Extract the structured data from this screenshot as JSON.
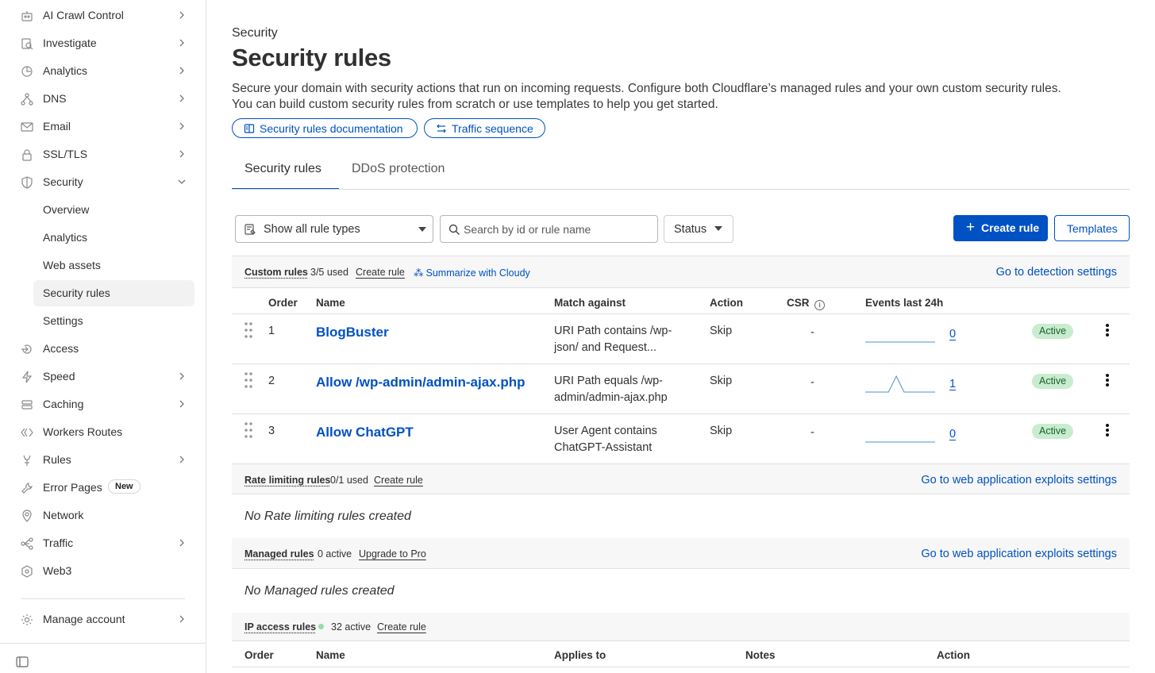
{
  "sidebar": {
    "items": [
      {
        "label": "AI Crawl Control",
        "icon": "robot-icon",
        "chevron": "right"
      },
      {
        "label": "Investigate",
        "icon": "investigate-icon",
        "chevron": "right"
      },
      {
        "label": "Analytics",
        "icon": "analytics-icon",
        "chevron": "right"
      },
      {
        "label": "DNS",
        "icon": "dns-icon",
        "chevron": "right"
      },
      {
        "label": "Email",
        "icon": "email-icon",
        "chevron": "right"
      },
      {
        "label": "SSL/TLS",
        "icon": "lock-icon",
        "chevron": "right"
      },
      {
        "label": "Security",
        "icon": "shield-icon",
        "chevron": "down"
      }
    ],
    "security_sub": [
      "Overview",
      "Analytics",
      "Web assets",
      "Security rules",
      "Settings"
    ],
    "items_after": [
      {
        "label": "Access",
        "icon": "access-icon",
        "chevron": ""
      },
      {
        "label": "Speed",
        "icon": "lightning-icon",
        "chevron": "right"
      },
      {
        "label": "Caching",
        "icon": "caching-icon",
        "chevron": "right"
      },
      {
        "label": "Workers Routes",
        "icon": "workers-icon",
        "chevron": ""
      },
      {
        "label": "Rules",
        "icon": "rules-icon",
        "chevron": "right"
      },
      {
        "label": "Error Pages",
        "icon": "wrench-icon",
        "chevron": "",
        "badge": "New"
      },
      {
        "label": "Network",
        "icon": "location-pin-icon",
        "chevron": ""
      },
      {
        "label": "Traffic",
        "icon": "traffic-icon",
        "chevron": "right"
      },
      {
        "label": "Web3",
        "icon": "web3-icon",
        "chevron": ""
      }
    ],
    "manage_account": "Manage account"
  },
  "header": {
    "breadcrumb": "Security",
    "title": "Security rules",
    "description_1": "Secure your domain with security actions that run on incoming requests. Configure both Cloudflare’s managed rules and your own custom security rules.",
    "description_2": "You can build custom security rules from scratch or use templates to help you get started.",
    "doc_link": "Security rules documentation",
    "traffic_link": "Traffic sequence"
  },
  "tabs": [
    "Security rules",
    "DDoS protection"
  ],
  "toolbar": {
    "rule_types": "Show all rule types",
    "search_placeholder": "Search by id or rule name",
    "status": "Status",
    "create_rule": "Create rule",
    "templates": "Templates"
  },
  "custom_rules": {
    "name": "Custom rules",
    "used": "3/5 used",
    "create": "Create rule",
    "cloudy": "Summarize with Cloudy",
    "right_link": "Go to detection settings",
    "columns": [
      "Order",
      "Name",
      "Match against",
      "Action",
      "CSR",
      "Events last 24h"
    ],
    "rows": [
      {
        "order": "1",
        "name": "BlogBuster",
        "match_1": "URI Path contains /wp-",
        "match_2": "json/ and Request...",
        "action": "Skip",
        "csr": "-",
        "events": "0",
        "status": "Active",
        "spark": [
          0,
          0,
          0,
          0,
          0,
          0,
          0,
          0,
          0,
          0
        ]
      },
      {
        "order": "2",
        "name": "Allow /wp-admin/admin-ajax.php",
        "match_1": "URI Path equals /wp-",
        "match_2": "admin/admin-ajax.php",
        "action": "Skip",
        "csr": "-",
        "events": "1",
        "status": "Active",
        "spark": [
          0,
          0,
          0,
          0,
          1,
          0,
          0,
          0,
          0,
          0
        ]
      },
      {
        "order": "3",
        "name": "Allow ChatGPT",
        "match_1": "User Agent contains",
        "match_2": "ChatGPT-Assistant",
        "action": "Skip",
        "csr": "-",
        "events": "0",
        "status": "Active",
        "spark": [
          0,
          0,
          0,
          0,
          0,
          0,
          0,
          0,
          0,
          0
        ]
      }
    ]
  },
  "rate_limiting": {
    "name": "Rate limiting rules",
    "used": "0/1 used",
    "create": "Create rule",
    "right_link": "Go to web application exploits settings",
    "empty": "No Rate limiting rules created"
  },
  "managed_rules": {
    "name": "Managed rules",
    "active": "0 active",
    "upgrade": "Upgrade to Pro",
    "right_link": "Go to web application exploits settings",
    "empty": "No Managed rules created"
  },
  "ip_access": {
    "name": "IP access rules",
    "active": "32 active",
    "create": "Create rule",
    "columns": [
      "Order",
      "Name",
      "Applies to",
      "Notes",
      "Action"
    ]
  },
  "colors": {
    "accent": "#0051c3",
    "active_badge_bg": "#c8eccf",
    "status_dot": "#9adba7"
  }
}
